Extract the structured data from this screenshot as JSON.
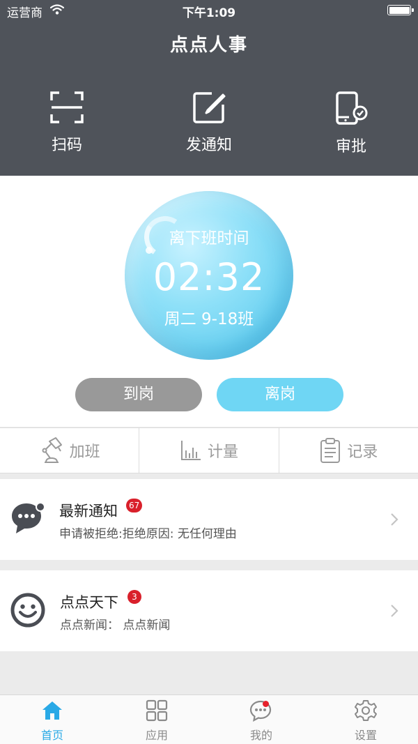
{
  "status_bar": {
    "carrier": "运营商",
    "time": "下午1:09"
  },
  "header": {
    "title": "点点人事",
    "actions": [
      {
        "label": "扫码",
        "icon": "scan-icon"
      },
      {
        "label": "发通知",
        "icon": "edit-icon"
      },
      {
        "label": "审批",
        "icon": "phone-check-icon"
      }
    ]
  },
  "clock": {
    "caption": "离下班时间",
    "countdown": "02:32",
    "shift": "周二 9-18班"
  },
  "buttons": {
    "arrive": "到岗",
    "leave": "离岗"
  },
  "tools": [
    {
      "label": "加班",
      "icon": "desk-lamp-icon"
    },
    {
      "label": "计量",
      "icon": "bar-chart-icon"
    },
    {
      "label": "记录",
      "icon": "clipboard-icon"
    }
  ],
  "feed": [
    {
      "title": "最新通知",
      "badge": "67",
      "subtitle": "申请被拒绝:拒绝原因: 无任何理由",
      "icon": "chat-bubble-icon"
    },
    {
      "title": "点点天下",
      "badge": "3",
      "subtitle": "点点新闻：  点点新闻",
      "icon": "smiley-icon"
    }
  ],
  "tabbar": [
    {
      "label": "首页",
      "icon": "home-icon",
      "active": true
    },
    {
      "label": "应用",
      "icon": "grid-icon",
      "active": false
    },
    {
      "label": "我的",
      "icon": "message-icon",
      "active": false
    },
    {
      "label": "设置",
      "icon": "gear-icon",
      "active": false
    }
  ],
  "colors": {
    "header_bg": "#4f535a",
    "accent": "#29a9e6",
    "leave_button": "#6fd6f4",
    "arrive_button": "#999999",
    "badge": "#d9202b"
  }
}
